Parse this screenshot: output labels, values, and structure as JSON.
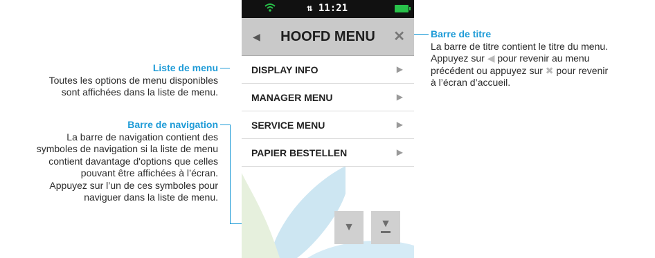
{
  "device": {
    "status_bar": {
      "time": "11:21",
      "wifi_icon": "wifi-icon",
      "transfer_icon": "transfer-icon",
      "battery_icon": "battery-icon"
    },
    "title_bar": {
      "back_glyph": "◀",
      "title": "HOOFD MENU",
      "close_glyph": "✕"
    },
    "menu_items": [
      {
        "label": "DISPLAY INFO",
        "arrow": "▶"
      },
      {
        "label": "MANAGER MENU",
        "arrow": "▶"
      },
      {
        "label": "SERVICE MENU",
        "arrow": "▶"
      },
      {
        "label": "PAPIER BESTELLEN",
        "arrow": "▶"
      }
    ],
    "nav_buttons": {
      "down_glyph": "▼",
      "end_glyph": "▼"
    },
    "colors": {
      "accent": "#1e9bd7",
      "title_bar": "#c9c9c9",
      "battery": "#28c24a"
    }
  },
  "annotations": {
    "menu_list": {
      "title": "Liste de menu",
      "lines": [
        "Toutes les options de menu disponibles",
        "sont affichées dans la liste de menu."
      ]
    },
    "nav_bar": {
      "title": "Barre de navigation",
      "lines": [
        "La barre de navigation contient des",
        "symboles de navigation si la liste de menu",
        "contient davantage d'options que celles",
        "pouvant être affichées à l’écran.",
        "Appuyez sur l’un de ces symboles pour",
        "naviguer dans la liste de menu."
      ]
    },
    "title_bar": {
      "title": "Barre de titre",
      "line1": "La barre de titre contient le titre du menu.",
      "line2a": "Appuyez sur ",
      "line2_icon": "◀",
      "line2b": " pour revenir au menu",
      "line3a": "précédent ou appuyez sur ",
      "line3_icon": "✖",
      "line3b": " pour revenir",
      "line4": "à l’écran d’accueil."
    }
  }
}
